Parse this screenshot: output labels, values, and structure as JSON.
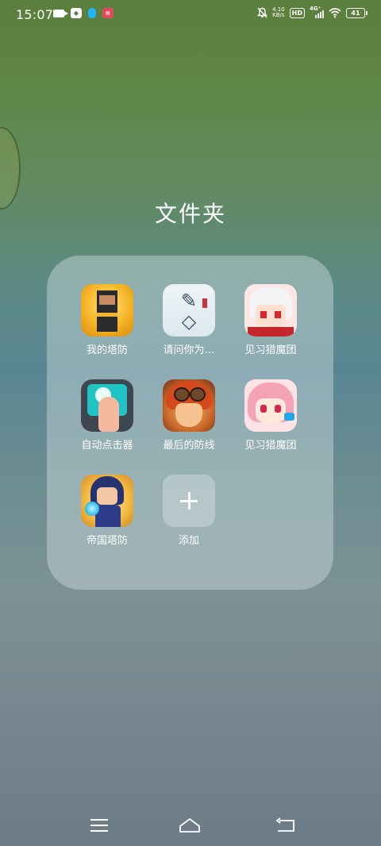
{
  "status_bar": {
    "time": "15:07",
    "net_speed_value": "4.10",
    "net_speed_unit": "KB/s",
    "hd_label": "HD",
    "signal_label": "4G⁺",
    "battery_level": "41",
    "left_icons": [
      "video-icon",
      "shield-app-icon",
      "qq-icon",
      "app-notification-icon"
    ],
    "right_icons": [
      "mute-icon",
      "hd-icon",
      "signal-icon",
      "wifi-icon",
      "battery-icon"
    ]
  },
  "folder": {
    "title": "文件夹",
    "apps": [
      {
        "label": "我的塔防",
        "icon": "tower-defense-icon"
      },
      {
        "label": "请问你为…",
        "icon": "qingwen-icon"
      },
      {
        "label": "见习猎魔团",
        "icon": "hunter-white-icon"
      },
      {
        "label": "自动点击器",
        "icon": "auto-clicker-icon"
      },
      {
        "label": "最后的防线",
        "icon": "last-defense-icon"
      },
      {
        "label": "见习猎魔团",
        "icon": "hunter-pink-icon"
      },
      {
        "label": "帝国塔防",
        "icon": "empire-defense-icon"
      }
    ],
    "add_label": "添加"
  },
  "nav_bar": {
    "items": [
      "menu-icon",
      "home-icon",
      "back-icon"
    ]
  }
}
